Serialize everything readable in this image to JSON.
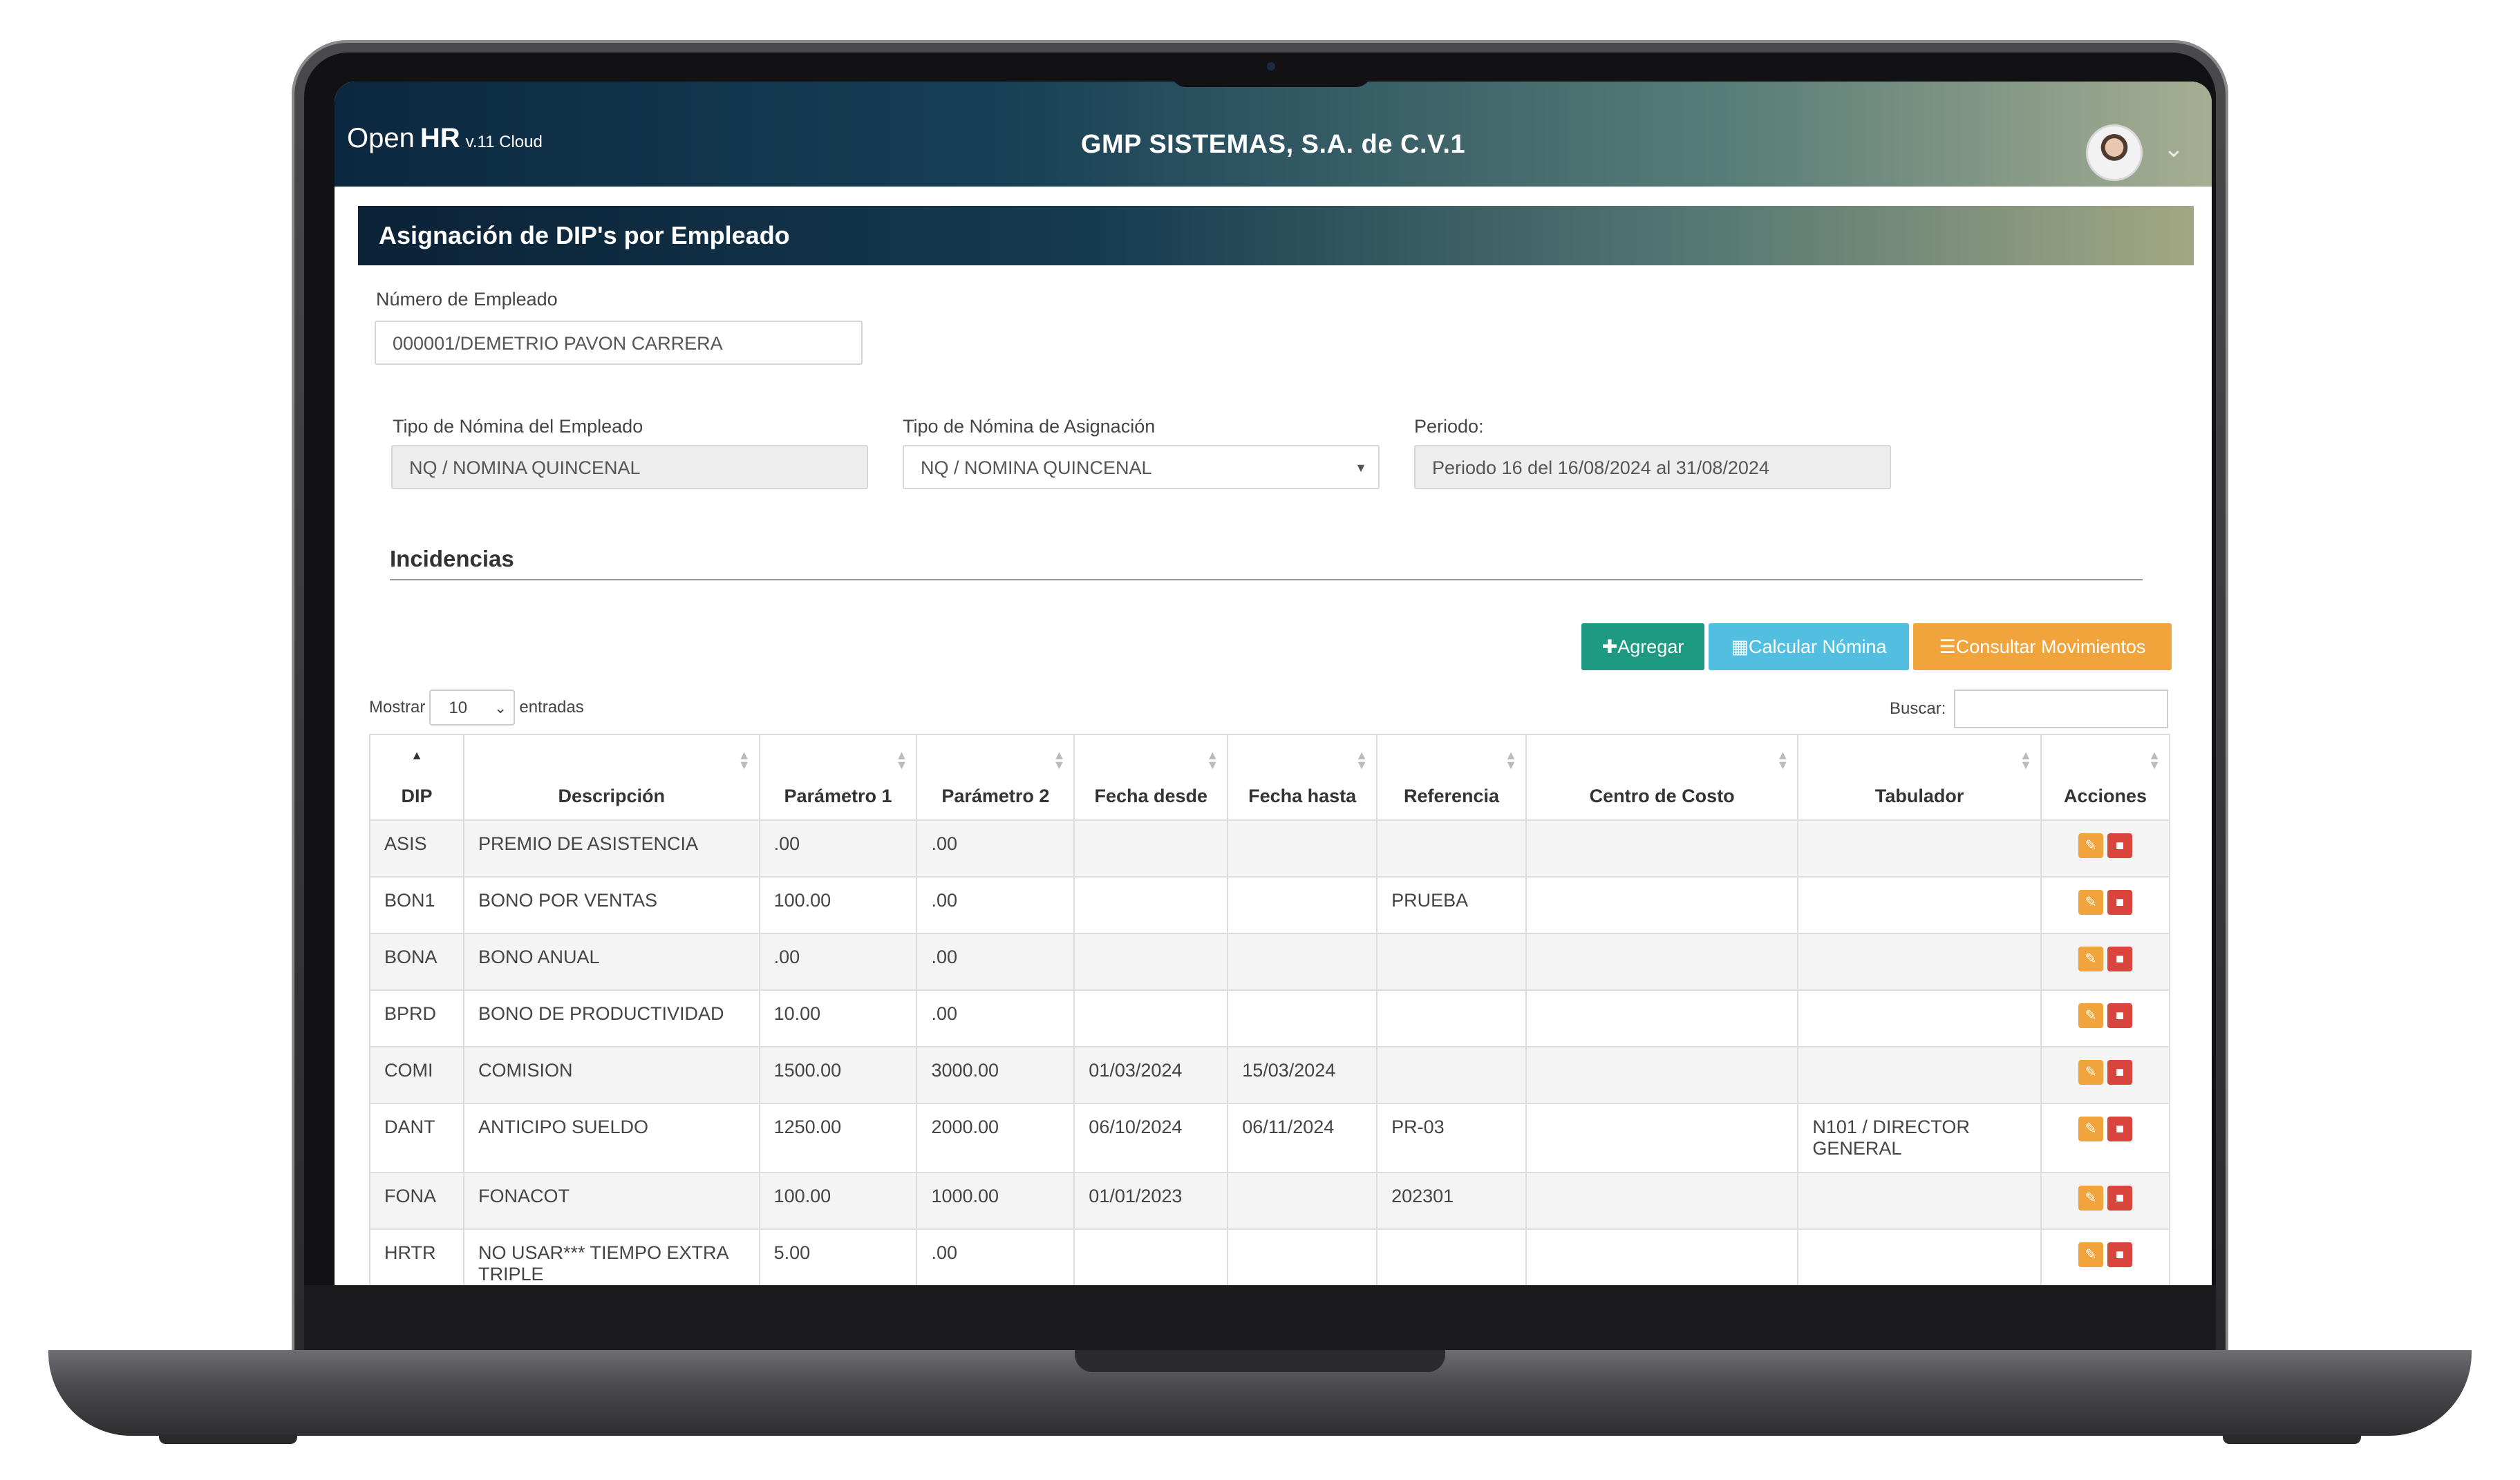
{
  "app": {
    "brand_open": "Open",
    "brand_hr": "HR",
    "brand_version": "v.11 Cloud",
    "company": "GMP SISTEMAS, S.A. de C.V.1"
  },
  "page_title": "Asignación de DIP's por Empleado",
  "form": {
    "employee_label": "Número de Empleado",
    "employee_value": "000001/DEMETRIO PAVON CARRERA",
    "nomina_emp_label": "Tipo de Nómina del Empleado",
    "nomina_emp_value": "NQ / NOMINA QUINCENAL",
    "nomina_asig_label": "Tipo de Nómina de Asignación",
    "nomina_asig_value": "NQ / NOMINA QUINCENAL",
    "periodo_label": "Periodo:",
    "periodo_value": "Periodo 16  del 16/08/2024 al 31/08/2024"
  },
  "section_title": "Incidencias",
  "buttons": {
    "add": "Agregar",
    "calc": "Calcular Nómina",
    "movements": "Consultar Movimientos"
  },
  "table_controls": {
    "show_label": "Mostrar",
    "show_value": "10",
    "entries_label": "entradas",
    "search_label": "Buscar:"
  },
  "columns": [
    "DIP",
    "Descripción",
    "Parámetro 1",
    "Parámetro 2",
    "Fecha desde",
    "Fecha hasta",
    "Referencia",
    "Centro de Costo",
    "Tabulador",
    "Acciones"
  ],
  "rows": [
    [
      "ASIS",
      "PREMIO DE ASISTENCIA",
      ".00",
      ".00",
      "",
      "",
      "",
      "",
      ""
    ],
    [
      "BON1",
      "BONO POR VENTAS",
      "100.00",
      ".00",
      "",
      "",
      "PRUEBA",
      "",
      ""
    ],
    [
      "BONA",
      "BONO ANUAL",
      ".00",
      ".00",
      "",
      "",
      "",
      "",
      ""
    ],
    [
      "BPRD",
      "BONO DE PRODUCTIVIDAD",
      "10.00",
      ".00",
      "",
      "",
      "",
      "",
      ""
    ],
    [
      "COMI",
      "COMISION",
      "1500.00",
      "3000.00",
      "01/03/2024",
      "15/03/2024",
      "",
      "",
      ""
    ],
    [
      "DANT",
      "ANTICIPO SUELDO",
      "1250.00",
      "2000.00",
      "06/10/2024",
      "06/11/2024",
      "PR-03",
      "",
      "N101 / DIRECTOR GENERAL"
    ],
    [
      "FONA",
      "FONACOT",
      "100.00",
      "1000.00",
      "01/01/2023",
      "",
      "202301",
      "",
      ""
    ],
    [
      "HRTR",
      "NO USAR*** TIEMPO EXTRA TRIPLE",
      "5.00",
      ".00",
      "",
      "",
      "",
      "",
      ""
    ]
  ],
  "colors": {
    "accent_green": "#1e9a82",
    "accent_blue": "#53bfe0",
    "accent_orange": "#f0a43b",
    "danger": "#d9453c"
  }
}
